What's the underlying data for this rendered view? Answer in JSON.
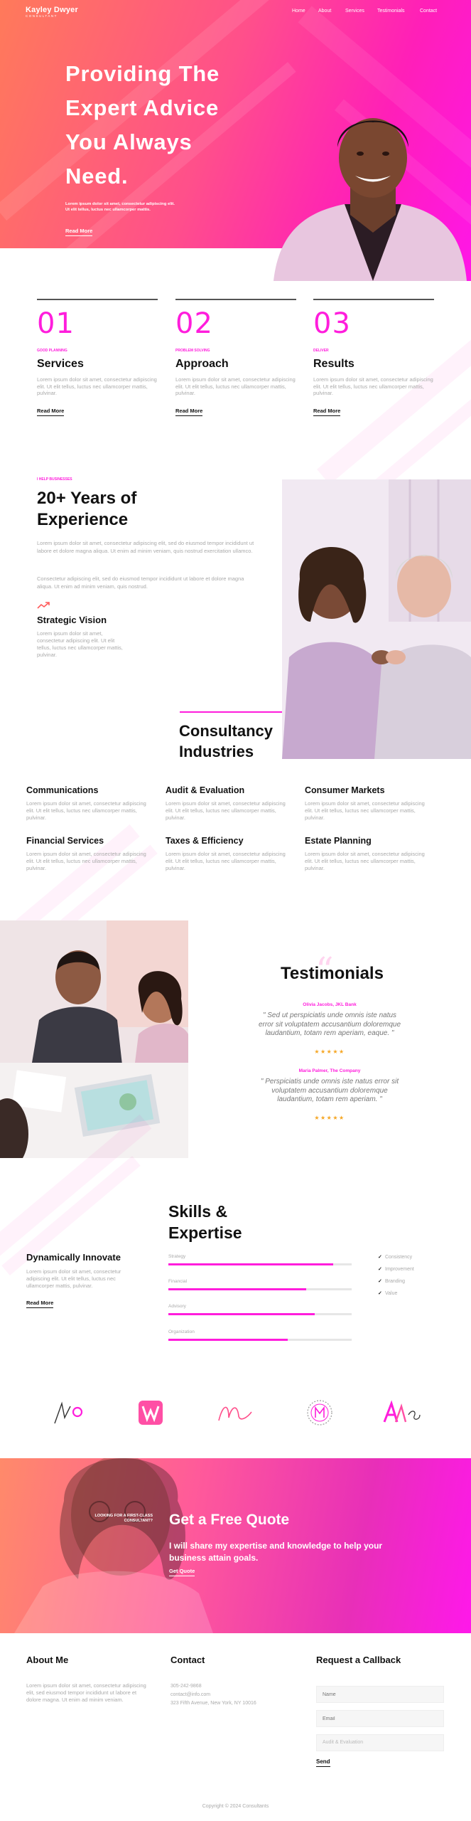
{
  "header": {
    "logo_name": "Kayley Dwyer",
    "logo_sub": "CONSULTANT",
    "nav": [
      "Home",
      "About",
      "Services",
      "Testimonials",
      "Contact"
    ]
  },
  "hero": {
    "title": "Providing The Expert Advice You Always Need.",
    "description": "Lorem ipsum dolor sit amet, consectetur adipiscing elit. Ut elit tellus, luctus nec ullamcorper mattis.",
    "cta": "Read More"
  },
  "services": [
    {
      "num": "01",
      "tag": "GOOD PLANNING",
      "title": "Services",
      "desc": "Lorem ipsum dolor sit amet, consectetur adipiscing elit. Ut elit tellus, luctus nec ullamcorper mattis, pulvinar.",
      "more": "Read More"
    },
    {
      "num": "02",
      "tag": "PROBLEM SOLVING",
      "title": "Approach",
      "desc": "Lorem ipsum dolor sit amet, consectetur adipiscing elit. Ut elit tellus, luctus nec ullamcorper mattis, pulvinar.",
      "more": "Read More"
    },
    {
      "num": "03",
      "tag": "DELIVER",
      "title": "Results",
      "desc": "Lorem ipsum dolor sit amet, consectetur adipiscing elit. Ut elit tellus, luctus nec ullamcorper mattis, pulvinar.",
      "more": "Read More"
    }
  ],
  "about": {
    "tag": "I HELP BUSINESSES",
    "title": "20+ Years of Experience",
    "p1": "Lorem ipsum dolor sit amet, consectetur adipiscing elit, sed do eiusmod tempor incididunt ut labore et dolore magna aliqua. Ut enim ad minim veniam, quis nostrud exercitation ullamco.",
    "p2": "Consectetur adipiscing elit, sed do eiusmod tempor incididunt ut labore et dolore magna aliqua. Ut enim ad minim veniam, quis nostrud.",
    "vision_title": "Strategic Vision",
    "vision_desc": "Lorem ipsum dolor sit amet, consectetur adipiscing elit. Ut elit tellus, luctus nec ullamcorper mattis, pulvinar."
  },
  "industries": {
    "title": "Consultancy Industries",
    "items": [
      {
        "name": "Communications",
        "desc": "Lorem ipsum dolor sit amet, consectetur adipiscing elit. Ut elit tellus, luctus nec ullamcorper mattis, pulvinar."
      },
      {
        "name": "Audit & Evaluation",
        "desc": "Lorem ipsum dolor sit amet, consectetur adipiscing elit. Ut elit tellus, luctus nec ullamcorper mattis, pulvinar."
      },
      {
        "name": "Consumer Markets",
        "desc": "Lorem ipsum dolor sit amet, consectetur adipiscing elit. Ut elit tellus, luctus nec ullamcorper mattis, pulvinar."
      },
      {
        "name": "Financial Services",
        "desc": "Lorem ipsum dolor sit amet, consectetur adipiscing elit. Ut elit tellus, luctus nec ullamcorper mattis, pulvinar."
      },
      {
        "name": "Taxes & Efficiency",
        "desc": "Lorem ipsum dolor sit amet, consectetur adipiscing elit. Ut elit tellus, luctus nec ullamcorper mattis, pulvinar."
      },
      {
        "name": "Estate Planning",
        "desc": "Lorem ipsum dolor sit amet, consectetur adipiscing elit. Ut elit tellus, luctus nec ullamcorper mattis, pulvinar."
      }
    ]
  },
  "testimonials": {
    "title": "Testimonials",
    "items": [
      {
        "author": "Olivia Jacobs, JKL Bank",
        "text": "\" Sed ut perspiciatis unde omnis iste natus error sit voluptatem accusantium doloremque laudantium, totam rem aperiam, eaque. \"",
        "stars": "★★★★★"
      },
      {
        "author": "Maria Palmer, The Company",
        "text": "\" Perspiciatis unde omnis iste natus error sit voluptatem accusantium doloremque laudantium, totam rem aperiam. \"",
        "stars": "★★★★★"
      }
    ]
  },
  "skills": {
    "title": "Skills & Expertise",
    "intro_title": "Dynamically Innovate",
    "intro_desc": "Lorem ipsum dolor sit amet, consectetur adipiscing elit. Ut elit tellus, luctus nec ullamcorper mattis, pulvinar.",
    "intro_more": "Read More",
    "bars": [
      {
        "label": "Strategy",
        "level": 0.9
      },
      {
        "label": "Financial",
        "level": 0.75
      },
      {
        "label": "Advisory",
        "level": 0.8
      },
      {
        "label": "Organization",
        "level": 0.65
      }
    ],
    "checklist": [
      "Consistency",
      "Improvement",
      "Branding",
      "Value"
    ]
  },
  "logos": [
    "logo-1",
    "logo-2",
    "logo-3",
    "logo-4",
    "logo-5"
  ],
  "quote": {
    "tag": "LOOKING FOR A FIRST-CLASS CONSULTANT?",
    "title": "Get a Free Quote",
    "desc": "I will share my expertise and knowledge to help your business attain goals.",
    "cta": "Get Quote"
  },
  "footer": {
    "about_title": "About Me",
    "about_text": "Lorem ipsum dolor sit amet, consectetur adipiscing elit, sed eiusmod tempor incididunt ut labore et dolore magna. Ut enim ad minim veniam.",
    "contact_title": "Contact",
    "contact_lines": [
      "305-242-9868",
      "contact@info.com",
      "323 Fifth Avenue, New York, NY 10016"
    ],
    "callback_title": "Request a Callback",
    "name_placeholder": "Name",
    "email_placeholder": "Email",
    "service_placeholder": "Audit & Evaluation",
    "send": "Send",
    "copyright": "Copyright © 2024 Consultants"
  },
  "colors": {
    "accent": "#ff1ddc",
    "star": "#f5a623"
  }
}
